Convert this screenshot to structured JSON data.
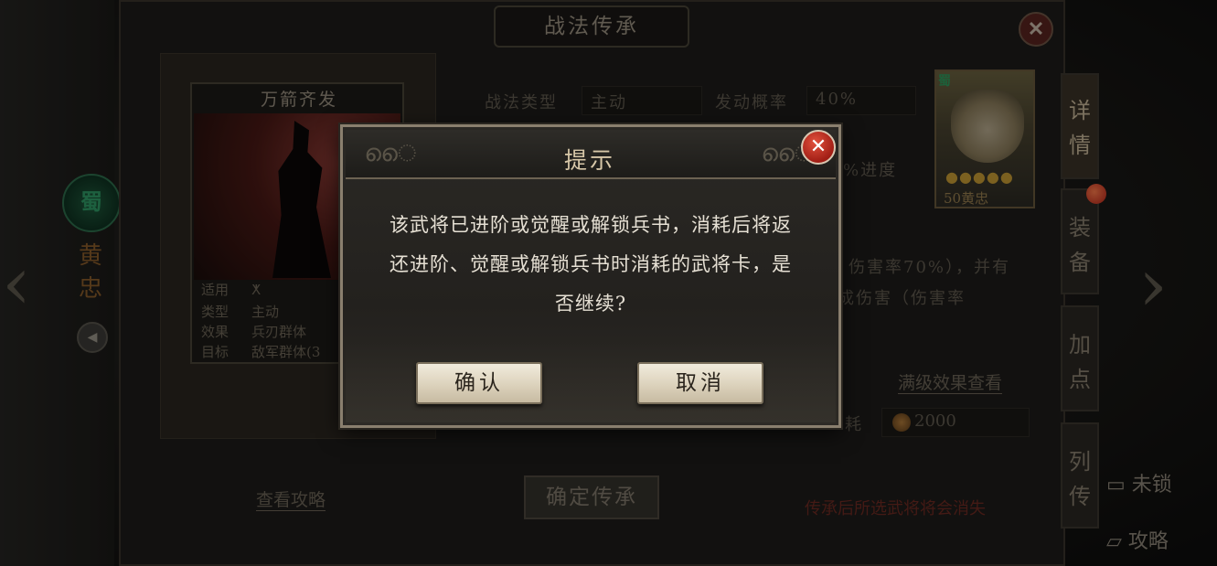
{
  "panel": {
    "title": "战法传承",
    "card": {
      "name": "万箭齐发",
      "rows": [
        {
          "key": "适用",
          "value": "ⵅ"
        },
        {
          "key": "类型",
          "value": "主动"
        },
        {
          "key": "效果",
          "value": "兵刃群体"
        },
        {
          "key": "目标",
          "value": "敌军群体(3"
        }
      ]
    },
    "info": {
      "type_label": "战法类型",
      "type_value": "主动",
      "rate_label": "发动概率",
      "rate_value": "40%",
      "progress_fragment": "%进度",
      "desc_line1": "伤害率70%），并有",
      "desc_line2": "成伤害（伤害率",
      "cost_fragment": "耗",
      "cost_value": "2000"
    },
    "links": {
      "max_effect": "满级效果查看",
      "view_guide": "查看攻略"
    },
    "confirm_inherit": "确定传承",
    "warning": "传承后所选武将将会消失"
  },
  "hero": {
    "faction": "蜀",
    "name": "黄忠",
    "portrait_faction": "蜀",
    "portrait_name": "50黄忠",
    "stars": "●●●●●"
  },
  "side_tabs": [
    "详情",
    "装备",
    "加点",
    "列传"
  ],
  "side_items": {
    "lock": "未锁",
    "guide": "攻略"
  },
  "dialog": {
    "title": "提示",
    "message_line1": "该武将已进阶或觉醒或解锁兵书，消耗后将返",
    "message_line2": "还进阶、觉醒或解锁兵书时消耗的武将卡，是",
    "message_line3": "否继续?",
    "confirm": "确认",
    "cancel": "取消",
    "close": "✕"
  },
  "colors": {
    "dialog_border": "#8a7f6e",
    "button_bg": "#e3dac6",
    "close_red": "#c0291d",
    "shu_green": "#2f9b66"
  }
}
